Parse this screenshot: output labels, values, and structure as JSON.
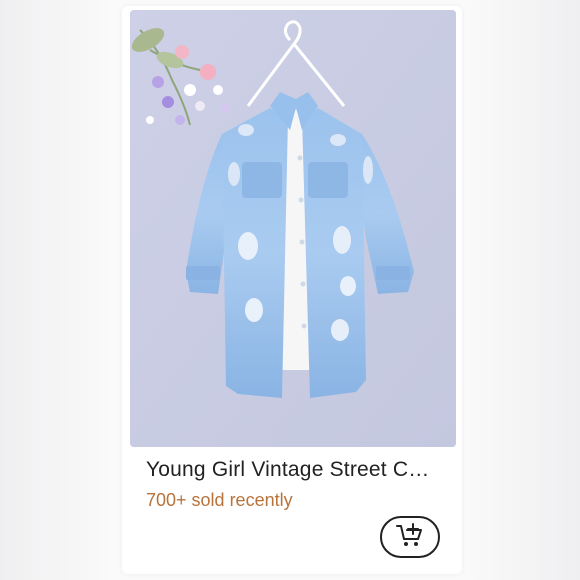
{
  "product": {
    "title": "Young Girl Vintage Street C…",
    "sold_text": "700+ sold recently",
    "image_icon": "denim-jacket-product-photo",
    "cart_icon": "add-to-cart-icon"
  },
  "colors": {
    "sold_text": "#b8733b",
    "image_background": "#c9cde3",
    "denim": "#8fb9e8"
  }
}
